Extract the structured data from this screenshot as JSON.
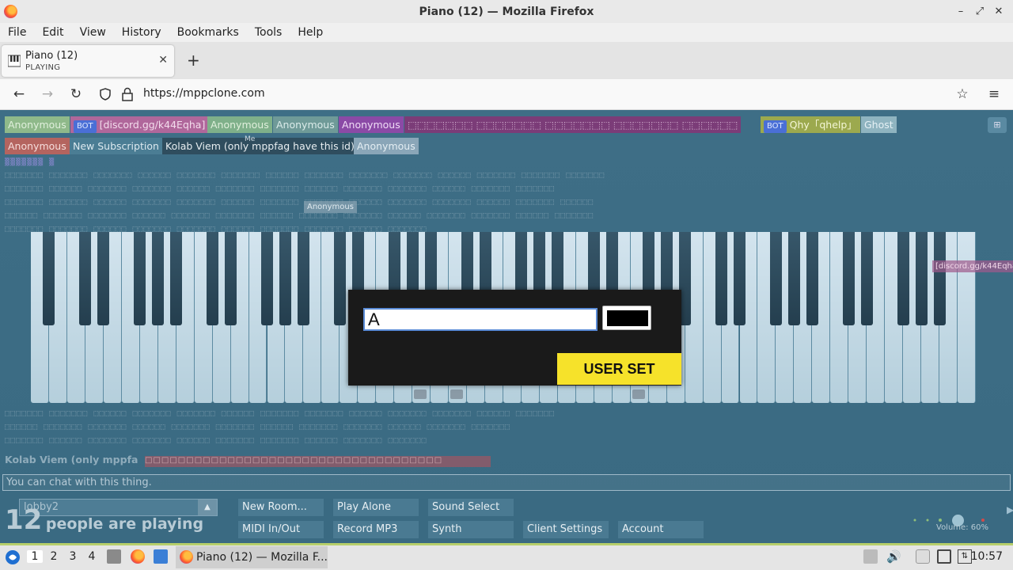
{
  "window": {
    "title": "Piano (12) — Mozilla Firefox"
  },
  "menu": [
    "File",
    "Edit",
    "View",
    "History",
    "Bookmarks",
    "Tools",
    "Help"
  ],
  "tab": {
    "title": "Piano (12)",
    "subtitle": "PLAYING"
  },
  "address": {
    "url": "https://mppclone.com"
  },
  "users_row1": [
    {
      "name": "Anonymous",
      "bg": "#8fb98a",
      "fg": "#e0f0dc",
      "bot": false
    },
    {
      "name": "[discord.gg/k44Eqha]",
      "bg": "#b0679b",
      "fg": "#f3dcec",
      "bot": true
    },
    {
      "name": "Anonymous",
      "bg": "#7fb08a",
      "fg": "#e0f0dc",
      "bot": false
    },
    {
      "name": "Anonymous",
      "bg": "#6f9a98",
      "fg": "#dbecea",
      "bot": false
    },
    {
      "name": "Anonymous",
      "bg": "#8b4aa6",
      "fg": "#f0dcf6",
      "bot": false
    },
    {
      "name": "⬚⬚⬚⬚⬚⬚⬚ ⬚⬚⬚⬚⬚⬚⬚ ⬚⬚⬚⬚⬚⬚⬚ ⬚⬚⬚⬚⬚⬚⬚ ⬚⬚⬚⬚⬚⬚",
      "bg": "#7b3c78",
      "fg": "#d9b8d6",
      "bot": false
    },
    {
      "name": "Qhy「qhelp」",
      "bg": "#9ca94e",
      "fg": "#f4f7d6",
      "bot": true
    },
    {
      "name": "Ghost",
      "bg": "#8fb4c0",
      "fg": "#e6f1f5",
      "bot": false
    }
  ],
  "users_row2": [
    {
      "name": "Anonymous",
      "bg": "#b4645f",
      "fg": "#f6dedc"
    },
    {
      "name": "New Subscription",
      "bg": "#4b7d94",
      "fg": "#dce9ef"
    },
    {
      "name": "Kolab Viem (only mppfag have this id)",
      "bg": "#2f4d5e",
      "fg": "#e8eef1"
    },
    {
      "name": "Anonymous",
      "bg": "#8aa6b8",
      "fg": "#e4eef3"
    }
  ],
  "cursor_labels": {
    "me": "Me",
    "anon": "Anonymous",
    "discord": "[discord.gg/k44Eqha"
  },
  "chat_partial": {
    "name": "Kolab Viem (only mppfa"
  },
  "modal": {
    "input_value": "A",
    "submit_label": "USER SET",
    "color": "#000000"
  },
  "chat": {
    "placeholder": "You can chat with this thing."
  },
  "room": {
    "name": "lobby2"
  },
  "players": {
    "count": "12",
    "label": "people are playing"
  },
  "buttons": {
    "new_room": "New Room...",
    "play_alone": "Play Alone",
    "sound_select": "Sound Select",
    "midi": "MIDI In/Out",
    "record": "Record MP3",
    "synth": "Synth",
    "client_settings": "Client Settings",
    "account": "Account"
  },
  "volume": {
    "label": "Volume: 60%",
    "level": 0.6
  },
  "taskbar": {
    "workspaces": [
      "1",
      "2",
      "3",
      "4"
    ],
    "task_title": "Piano (12) — Mozilla F...",
    "clock": "10:57"
  }
}
